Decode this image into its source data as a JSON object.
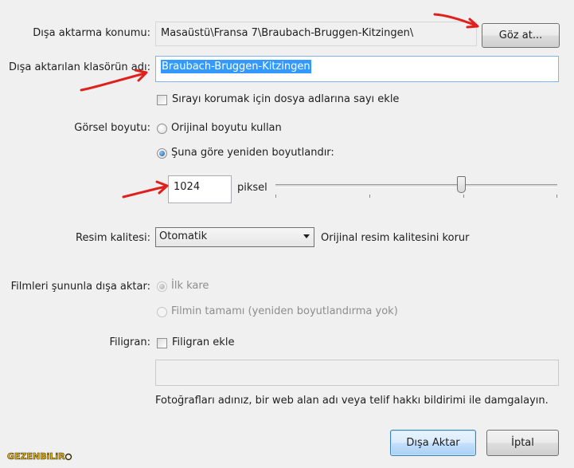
{
  "export": {
    "location_label": "Dışa aktarma konumu:",
    "location_value": "Masaüstü\\Fransa 7\\Braubach-Bruggen-Kitzingen\\",
    "browse_label": "Göz at...",
    "folder_label": "Dışa aktarılan klasörün adı:",
    "folder_value": "Braubach-Bruggen-Kitzingen",
    "order_checkbox_label": "Sırayı korumak için dosya adlarına sayı ekle"
  },
  "image_size": {
    "label": "Görsel boyutu:",
    "original_label": "Orijinal boyutu kullan",
    "resize_label": "Şuna göre yeniden boyutlandır:",
    "value": "1024",
    "unit": "piksel",
    "slider_fraction": 0.66
  },
  "quality": {
    "label": "Resim kalitesi:",
    "selected": "Otomatik",
    "note": "Orijinal resim kalitesini korur"
  },
  "movies": {
    "label": "Filmleri şununla dışa aktar:",
    "first_frame": "İlk kare",
    "whole_movie": "Filmin tamamı (yeniden boyutlandırma yok)"
  },
  "watermark": {
    "label": "Filigran:",
    "checkbox_label": "Filigran ekle",
    "text_value": "",
    "hint": "Fotoğrafları adınız, bir web alan adı veya telif hakkı bildirimi ile damgalayın."
  },
  "footer": {
    "export_button": "Dışa Aktar",
    "cancel_button": "İptal",
    "logo_text": "GEZENBiLiR"
  },
  "colors": {
    "annotation_arrow": "#e0201c",
    "selection": "#3399ff"
  }
}
